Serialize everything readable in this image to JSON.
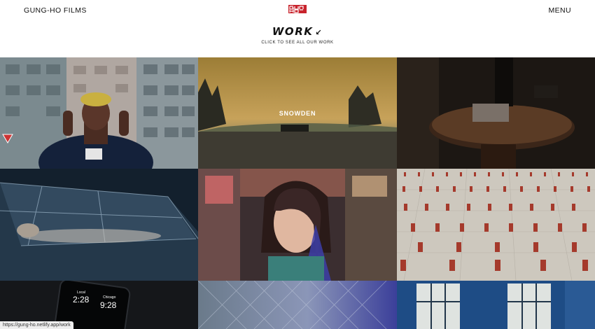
{
  "header": {
    "brand": "GUNG-HO FILMS",
    "menu": "MENU",
    "title": "WORK",
    "title_arrow": "↙",
    "subtitle": "CLICK TO SEE ALL OUR WORK"
  },
  "tiles": {
    "snowden_label": "SNOWDEN",
    "phone_local": "Local",
    "phone_time1": "2:28",
    "phone_chicago": "Chicago",
    "phone_time2": "9:28"
  },
  "status_bar": "https://gung-ho.netlify.app/work",
  "colors": {
    "logo_red": "#c8232c",
    "header_text": "#111111"
  }
}
